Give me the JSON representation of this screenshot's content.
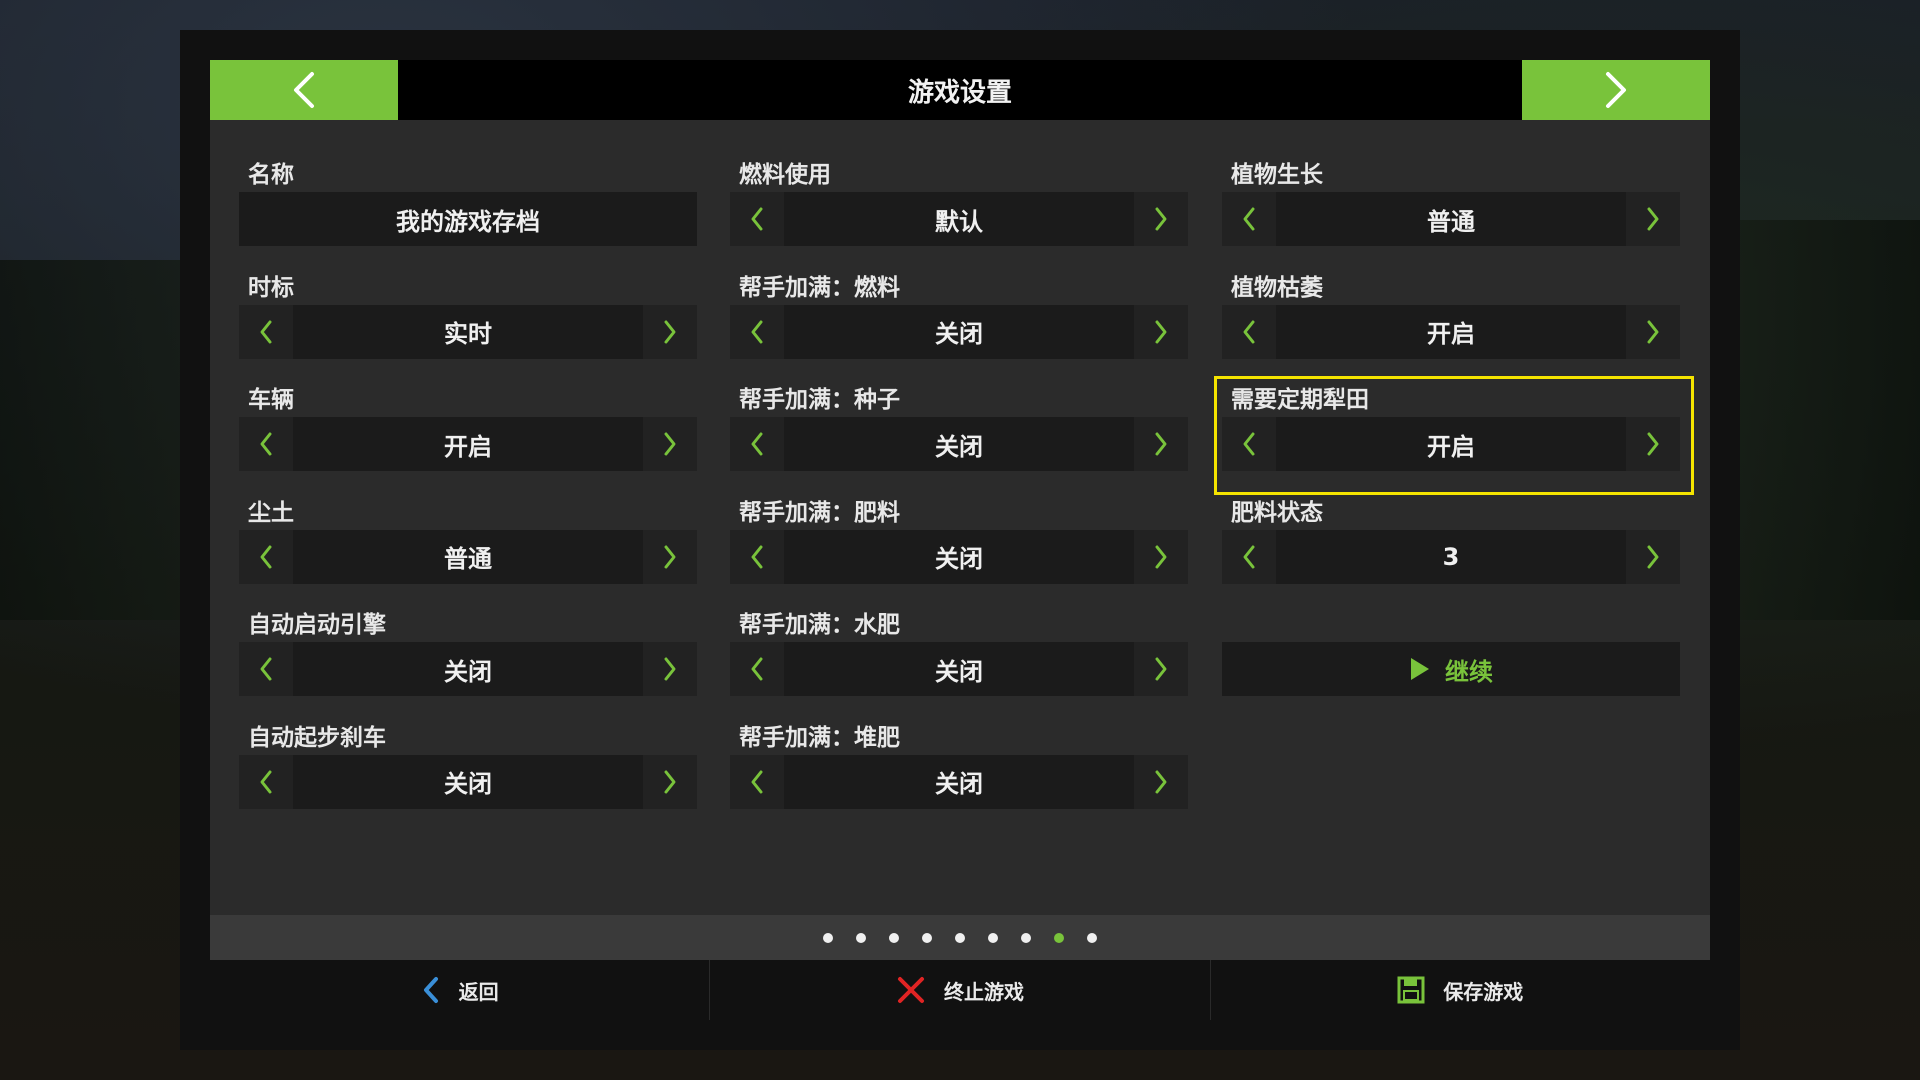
{
  "header": {
    "title": "游戏设置"
  },
  "columns": [
    {
      "settings": [
        {
          "label": "名称",
          "value": "我的游戏存档",
          "type": "text"
        },
        {
          "label": "时标",
          "value": "实时",
          "type": "arrows"
        },
        {
          "label": "车辆",
          "value": "开启",
          "type": "arrows"
        },
        {
          "label": "尘土",
          "value": "普通",
          "type": "arrows"
        },
        {
          "label": "自动启动引擎",
          "value": "关闭",
          "type": "arrows"
        },
        {
          "label": "自动起步刹车",
          "value": "关闭",
          "type": "arrows"
        }
      ]
    },
    {
      "settings": [
        {
          "label": "燃料使用",
          "value": "默认",
          "type": "arrows"
        },
        {
          "label": "帮手加满：燃料",
          "value": "关闭",
          "type": "arrows"
        },
        {
          "label": "帮手加满：种子",
          "value": "关闭",
          "type": "arrows"
        },
        {
          "label": "帮手加满：肥料",
          "value": "关闭",
          "type": "arrows"
        },
        {
          "label": "帮手加满：水肥",
          "value": "关闭",
          "type": "arrows"
        },
        {
          "label": "帮手加满：堆肥",
          "value": "关闭",
          "type": "arrows"
        }
      ]
    },
    {
      "settings": [
        {
          "label": "植物生长",
          "value": "普通",
          "type": "arrows"
        },
        {
          "label": "植物枯萎",
          "value": "开启",
          "type": "arrows"
        },
        {
          "label": "需要定期犁田",
          "value": "开启",
          "type": "arrows",
          "focused": true
        },
        {
          "label": "肥料状态",
          "value": "3",
          "type": "arrows"
        }
      ]
    }
  ],
  "continue": {
    "label": "继续"
  },
  "pager": {
    "pages": 9,
    "active_index": 7
  },
  "footer": {
    "back_label": "返回",
    "quit_label": "终止游戏",
    "save_label": "保存游戏"
  },
  "colors": {
    "accent": "#79c33b",
    "focus": "#f5e400",
    "quit": "#e02424",
    "back": "#3a8fd8"
  }
}
